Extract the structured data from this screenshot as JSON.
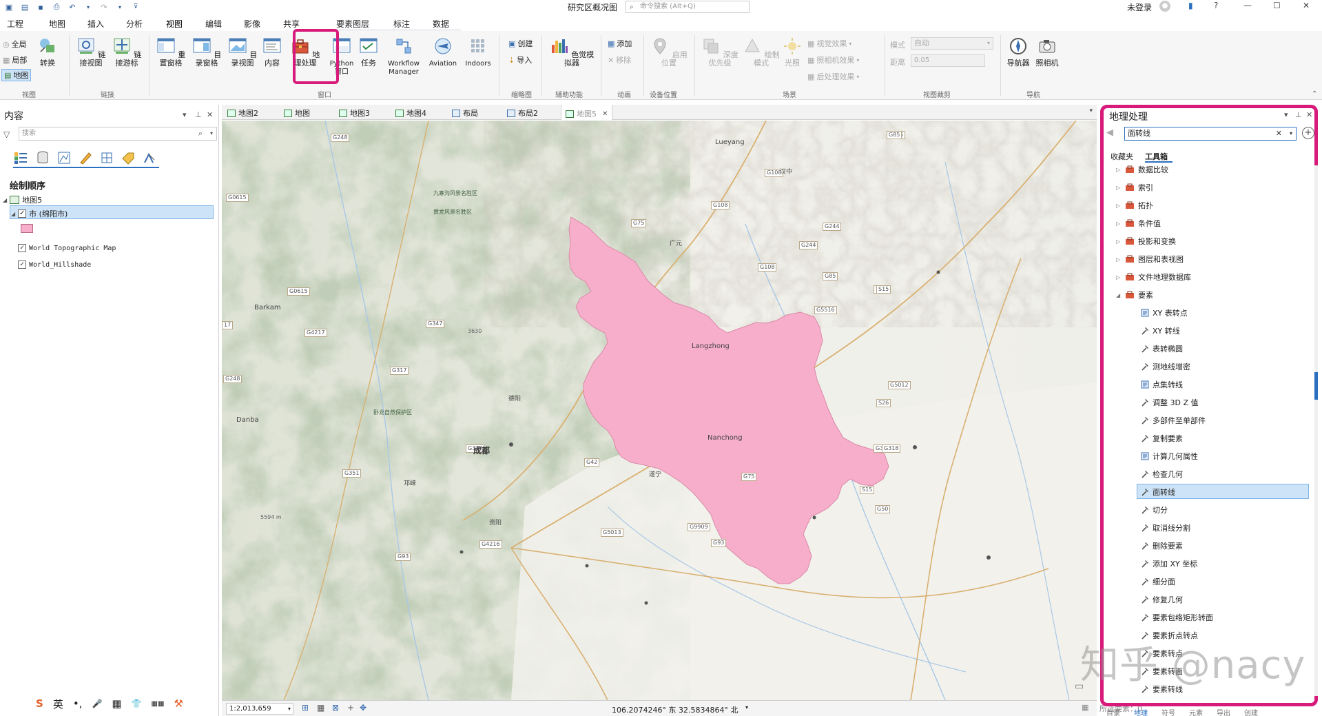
{
  "title_bar": {
    "doc_title": "研究区概况图",
    "search_placeholder": "命令搜索 (Alt+Q)",
    "user": "未登录",
    "help": "?"
  },
  "ribbon_tabs": [
    "工程",
    "地图",
    "插入",
    "分析",
    "视图",
    "编辑",
    "影像",
    "共享",
    "要素图层",
    "标注",
    "数据"
  ],
  "ribbon": {
    "view_group": {
      "label": "视图",
      "items": [
        "全局",
        "局部",
        "地图"
      ],
      "convert": "转换"
    },
    "link_group": {
      "label": "链接",
      "buttons": [
        "链接视图",
        "链接游标"
      ]
    },
    "window_group": {
      "label": "窗口",
      "buttons": [
        "重置窗格",
        "目录窗格",
        "目录视图",
        "内容",
        "地理处理",
        "Python 窗口",
        "任务",
        "Workflow Manager",
        "Aviation",
        "Indoors"
      ]
    },
    "thumbnail_group": {
      "label": "缩略图",
      "buttons": [
        "创建",
        "导入"
      ]
    },
    "accessibility_group": {
      "label": "辅助功能",
      "buttons": [
        "色觉模拟器"
      ]
    },
    "animation_group": {
      "label": "动画",
      "buttons": [
        "添加",
        "移除"
      ]
    },
    "device_group": {
      "label": "设备位置",
      "buttons": [
        "启用位置"
      ]
    },
    "scene_group": {
      "label": "场景",
      "buttons": [
        "深度优先级",
        "绘制模式",
        "光照",
        "视觉效果",
        "照相机效果",
        "后处理效果"
      ]
    },
    "viewcut_group": {
      "label": "视图裁剪",
      "mode_label": "模式",
      "mode_value": "自动",
      "dist_label": "距离",
      "dist_value": "0.05"
    },
    "nav_group": {
      "label": "导航",
      "buttons": [
        "导航器",
        "照相机"
      ]
    }
  },
  "content_pane": {
    "title": "内容",
    "search_placeholder": "搜索",
    "draw_order": "绘制顺序",
    "map_name": "地图5",
    "layer_selected": "市 (绵阳市)",
    "layers": [
      "World Topographic Map",
      "World_Hillshade"
    ]
  },
  "doc_tabs": [
    "地图2",
    "地图",
    "地图3",
    "地图4",
    "布局",
    "布局2",
    "地图5"
  ],
  "map_labels": [
    {
      "t": "G248",
      "k": "road"
    },
    {
      "t": "G0615",
      "k": "road"
    },
    {
      "t": "G0615",
      "k": "road"
    },
    {
      "t": "G4217",
      "k": "road"
    },
    {
      "t": "G347",
      "k": "road"
    },
    {
      "t": "G317",
      "k": "road"
    },
    {
      "t": "G248",
      "k": "road"
    },
    {
      "t": "G351",
      "k": "road"
    },
    {
      "t": "G317",
      "k": "road"
    },
    {
      "t": "G42",
      "k": "road"
    },
    {
      "t": "G75",
      "k": "road"
    },
    {
      "t": "G108",
      "k": "road"
    },
    {
      "t": "G108",
      "k": "road"
    },
    {
      "t": "G108",
      "k": "road"
    },
    {
      "t": "G244",
      "k": "road"
    },
    {
      "t": "G244",
      "k": "road"
    },
    {
      "t": "G85",
      "k": "road"
    },
    {
      "t": "G85",
      "k": "road"
    },
    {
      "t": "G5516",
      "k": "road"
    },
    {
      "t": "S15",
      "k": "road"
    },
    {
      "t": "S26",
      "k": "road"
    },
    {
      "t": "G318",
      "k": "road"
    },
    {
      "t": "G75",
      "k": "road"
    },
    {
      "t": "G5013",
      "k": "road"
    },
    {
      "t": "G4216",
      "k": "road"
    },
    {
      "t": "G93",
      "k": "road"
    },
    {
      "t": "G93",
      "k": "road"
    },
    {
      "t": "G9909",
      "k": "road"
    },
    {
      "t": "S15",
      "k": "road"
    },
    {
      "t": "G50",
      "k": "road"
    },
    {
      "t": "G5012",
      "k": "road"
    },
    {
      "t": "G318",
      "k": "road"
    },
    {
      "t": "S15",
      "k": "road"
    },
    {
      "t": "G85",
      "k": "road"
    },
    {
      "t": "Barkam",
      "k": "city"
    },
    {
      "t": "Danba",
      "k": "city"
    },
    {
      "t": "Lueyang",
      "k": "city"
    },
    {
      "t": "Langzhong",
      "k": "city"
    },
    {
      "t": "Nanchong",
      "k": "city"
    },
    {
      "t": "成都",
      "k": "bigcity"
    },
    {
      "t": "德阳",
      "k": "town"
    },
    {
      "t": "广元",
      "k": "town"
    },
    {
      "t": "遂宁",
      "k": "town"
    },
    {
      "t": "资阳",
      "k": "town"
    },
    {
      "t": "邛崃",
      "k": "town"
    },
    {
      "t": "汉中",
      "k": "town"
    },
    {
      "t": "九寨沟风景名胜区",
      "k": "park"
    },
    {
      "t": "黄龙风景名胜区",
      "k": "park"
    },
    {
      "t": "卧龙自然保护区",
      "k": "park"
    },
    {
      "t": "3630",
      "k": "elev"
    },
    {
      "t": "5594 m",
      "k": "elev"
    },
    {
      "t": "17",
      "k": "road"
    }
  ],
  "status_bar": {
    "scale": "1:2,013,659",
    "coords": "106.2074246° 东 32.5834864° 北",
    "selected": "所选要素：0"
  },
  "gp_pane": {
    "title": "地理处理",
    "search_value": "面转线",
    "tabs": [
      "收藏夹",
      "工具箱"
    ],
    "toolboxes": [
      "数据比较",
      "索引",
      "拓扑",
      "条件值",
      "投影和变换",
      "图层和表视图",
      "文件地理数据库",
      "要素"
    ],
    "tools": [
      {
        "n": "XY 表转点",
        "s": "s"
      },
      {
        "n": "XY 转线",
        "s": "t"
      },
      {
        "n": "表转椭圆",
        "s": "t"
      },
      {
        "n": "测地线增密",
        "s": "t"
      },
      {
        "n": "点集转线",
        "s": "s"
      },
      {
        "n": "调整 3D Z 值",
        "s": "t"
      },
      {
        "n": "多部件至单部件",
        "s": "t"
      },
      {
        "n": "复制要素",
        "s": "t"
      },
      {
        "n": "计算几何属性",
        "s": "s"
      },
      {
        "n": "检查几何",
        "s": "t"
      },
      {
        "n": "面转线",
        "s": "t"
      },
      {
        "n": "切分",
        "s": "t"
      },
      {
        "n": "取消线分割",
        "s": "t"
      },
      {
        "n": "删除要素",
        "s": "t"
      },
      {
        "n": "添加 XY 坐标",
        "s": "t"
      },
      {
        "n": "细分面",
        "s": "t"
      },
      {
        "n": "修复几何",
        "s": "t"
      },
      {
        "n": "要素包络矩形转面",
        "s": "t"
      },
      {
        "n": "要素折点转点",
        "s": "t"
      },
      {
        "n": "要素转点",
        "s": "t"
      },
      {
        "n": "要素转面",
        "s": "t"
      },
      {
        "n": "要素转线",
        "s": "t"
      }
    ],
    "bottom_tabs": [
      "目录",
      "地理",
      "符号",
      "元素",
      "导出",
      "创建"
    ]
  },
  "watermark": "知乎 @nacy",
  "ime": [
    "S",
    "英",
    "•,",
    "🎤",
    "▦",
    "👕",
    "▦▦",
    "⚒"
  ],
  "colors": {
    "highlight": "#d81b7a",
    "polygon": "#f7aecb",
    "selection": "#cde3f7",
    "accent": "#2a6fc0"
  }
}
